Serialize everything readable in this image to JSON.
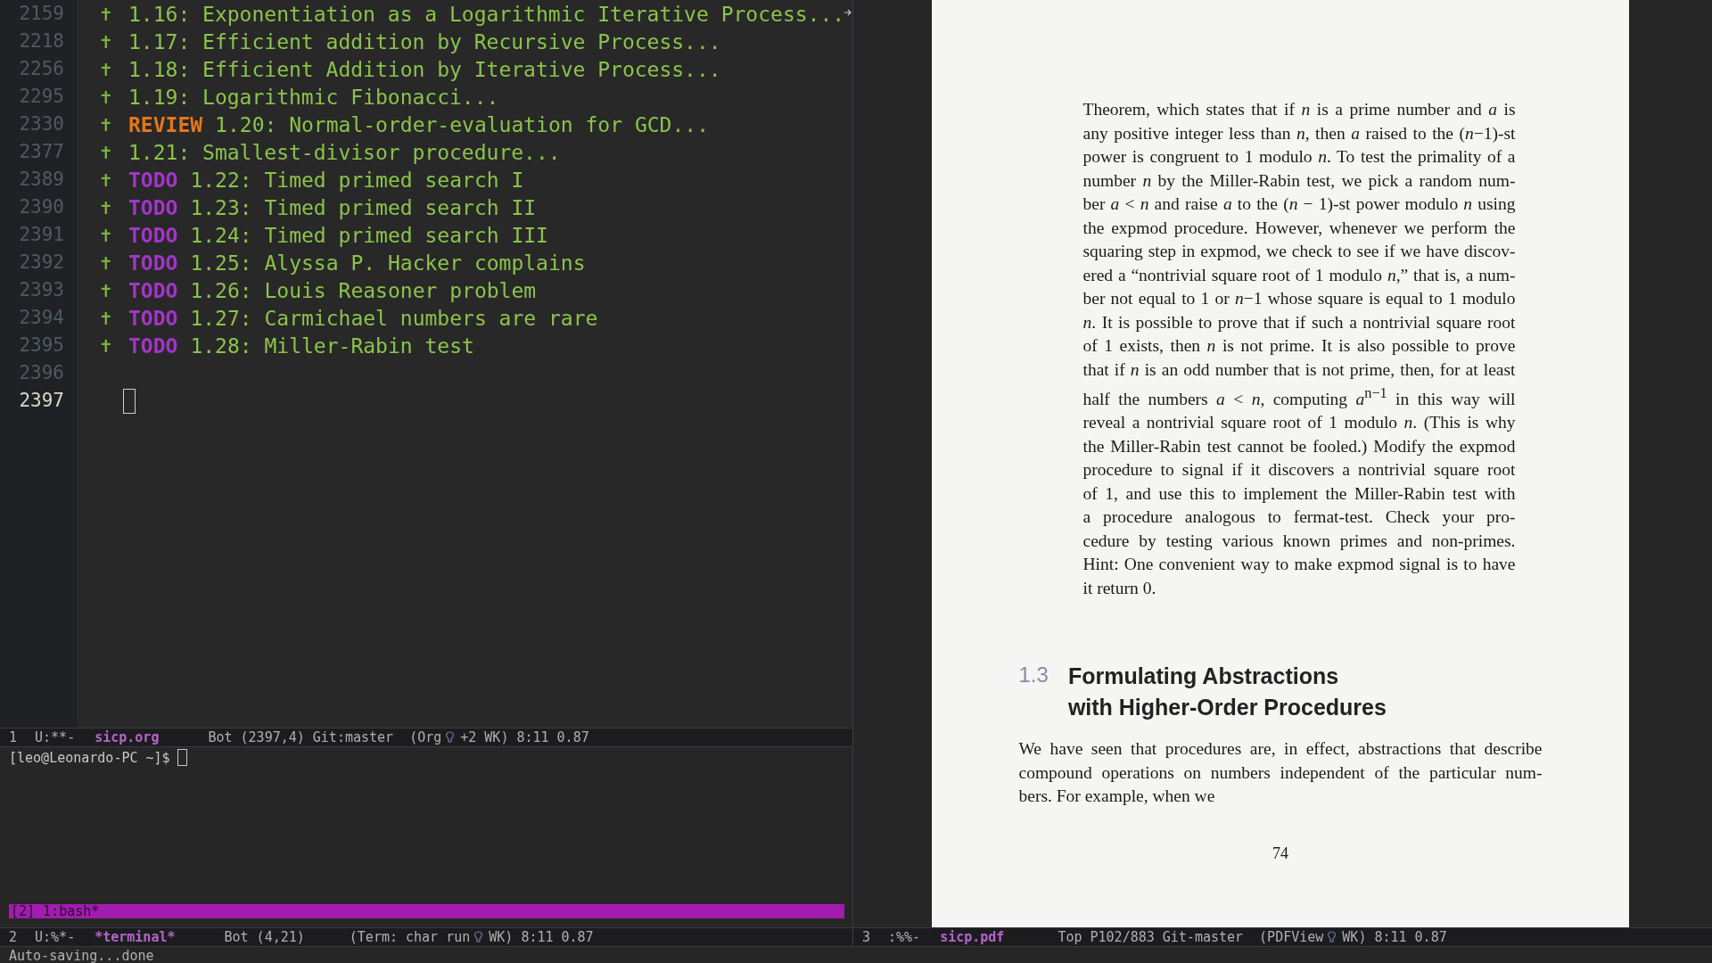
{
  "editor": {
    "lines": [
      {
        "number": "2159",
        "bullet": "✝",
        "text": "1.16: Exponentiation as a Logarithmic Iterative Process...",
        "truncated": true,
        "cursor": false
      },
      {
        "number": "2218",
        "bullet": "✝",
        "text": "1.17: Efficient addition by Recursive Process...",
        "cursor": false
      },
      {
        "number": "2256",
        "bullet": "✝",
        "text": "1.18: Efficient Addition by Iterative Process...",
        "cursor": false
      },
      {
        "number": "2295",
        "bullet": "✝",
        "text": "1.19: Logarithmic Fibonacci...",
        "cursor": false
      },
      {
        "number": "2330",
        "bullet": "✝",
        "keyword": {
          "text": "REVIEW",
          "color": "#e3771b"
        },
        "text": "1.20: Normal-order-evaluation for GCD...",
        "cursor": false
      },
      {
        "number": "2377",
        "bullet": "✝",
        "text": "1.21: Smallest-divisor procedure...",
        "cursor": false
      },
      {
        "number": "2389",
        "bullet": "✝",
        "keyword": {
          "text": "TODO",
          "color": "#a335c8"
        },
        "text": "1.22: Timed primed search I",
        "cursor": false
      },
      {
        "number": "2390",
        "bullet": "✝",
        "keyword": {
          "text": "TODO",
          "color": "#a335c8"
        },
        "text": "1.23: Timed primed search II",
        "cursor": false
      },
      {
        "number": "2391",
        "bullet": "✝",
        "keyword": {
          "text": "TODO",
          "color": "#a335c8"
        },
        "text": "1.24: Timed primed search III",
        "cursor": false
      },
      {
        "number": "2392",
        "bullet": "✝",
        "keyword": {
          "text": "TODO",
          "color": "#a335c8"
        },
        "text": "1.25: Alyssa P. Hacker complains",
        "cursor": false
      },
      {
        "number": "2393",
        "bullet": "✝",
        "keyword": {
          "text": "TODO",
          "color": "#a335c8"
        },
        "text": "1.26: Louis Reasoner problem",
        "cursor": false
      },
      {
        "number": "2394",
        "bullet": "✝",
        "keyword": {
          "text": "TODO",
          "color": "#a335c8"
        },
        "text": "1.27: Carmichael numbers are rare",
        "cursor": false
      },
      {
        "number": "2395",
        "bullet": "✝",
        "keyword": {
          "text": "TODO",
          "color": "#a335c8"
        },
        "text": "1.28: Miller-Rabin test",
        "cursor": false
      },
      {
        "number": "2396",
        "cursor": false
      },
      {
        "number": "2397",
        "cursor": true
      }
    ]
  },
  "modeline_org": {
    "window": "1",
    "flags": "U:**-",
    "buffer": "sicp.org",
    "position": "Bot (2397,4)",
    "vc": "Git:master",
    "mode_prefix": "(Org",
    "mode_suffix": "+2 WK)",
    "time_load": "8:11 0.87"
  },
  "terminal": {
    "prompt": "[leo@Leonardo-PC ~]$",
    "tmux_status": "[2] 1:bash*"
  },
  "modeline_terminal": {
    "window": "2",
    "flags": "U:%*-",
    "buffer": "*terminal*",
    "position": "Bot (4,21)",
    "mode_prefix": "(Term: char run",
    "mode_suffix": "WK)",
    "time_load": "8:11 0.87"
  },
  "pdf": {
    "paragraph_lines": [
      "Theorem, which states that if *n* is a prime number and *a* is",
      "any positive integer less than *n*, then *a* raised to the (*n*−1)-st",
      "power is congruent to 1 modulo *n*. To test the primality of a",
      "number *n* by the Miller-Rabin test, we pick a random num-",
      "ber *a* < *n* and raise *a* to the (*n* − 1)-st power modulo *n* using",
      "the expmod procedure. However, whenever we perform the",
      "squaring step in expmod, we check to see if we have discov-",
      "ered a “nontrivial square root of 1 modulo *n*,” that is, a num-",
      "ber not equal to 1 or *n*−1 whose square is equal to 1 modulo",
      "*n*. It is possible to prove that if such a nontrivial square root",
      "of 1 exists, then *n* is not prime. It is also possible to prove",
      "that if *n* is an odd number that is not prime, then, for at least",
      "half the numbers *a* < *n*, computing *a*$^{n−1}$ in this way will",
      "reveal a nontrivial square root of 1 modulo *n*. (This is why",
      "the Miller-Rabin test cannot be fooled.) Modify the expmod",
      "procedure to signal if it discovers a nontrivial square root",
      "of 1, and use this to implement the Miller-Rabin test with",
      "a procedure analogous to fermat-test. Check your pro-",
      "cedure by testing various known primes and non-primes.",
      "Hint: One convenient way to make expmod signal is to have",
      "it return 0."
    ],
    "section_number": "1.3",
    "section_title_lines": [
      "Formulating Abstractions",
      "with Higher-Order Procedures"
    ],
    "intro_lines": [
      "We have seen that procedures are, in effect, abstractions that describe",
      "compound operations on numbers independent of the particular num-",
      "bers. For example, when we"
    ],
    "page_number": "74"
  },
  "modeline_pdf": {
    "window": "3",
    "flags": ":%%-",
    "buffer": "sicp.pdf",
    "position": "Top P102/883",
    "vc": "Git-master",
    "mode_prefix": "(PDFView",
    "mode_suffix": "WK)",
    "time_load": "8:11 0.87"
  },
  "minibuffer": "Auto-saving...done"
}
